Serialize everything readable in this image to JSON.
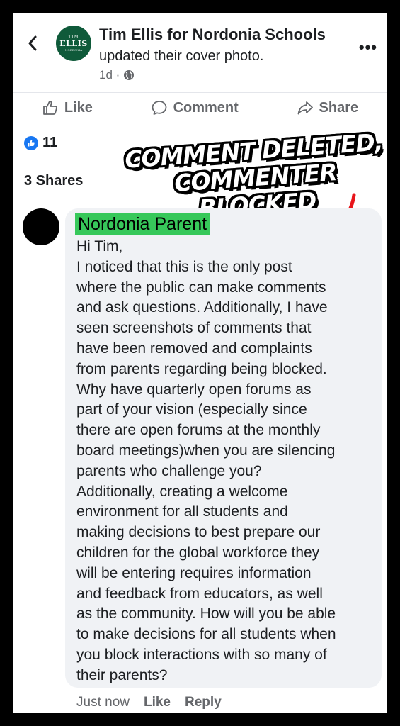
{
  "post": {
    "page_name": "Tim Ellis for Nordonia Schools",
    "action": "updated their cover photo.",
    "time": "1d ·",
    "logo_text": "ELLIS"
  },
  "icons": {
    "back": "chevron-left-icon",
    "more": "more-options-icon",
    "privacy": "globe-icon",
    "like": "thumbs-up-icon",
    "comment": "speech-bubble-icon",
    "share": "share-arrow-icon"
  },
  "actions": {
    "like_label": "Like",
    "comment_label": "Comment",
    "share_label": "Share"
  },
  "stats": {
    "likes": "11",
    "shares": "3 Shares"
  },
  "overlay": {
    "line1": "COMMENT DELETED,",
    "line2": "COMMENTER BLOCKED",
    "color": "#e8151b"
  },
  "comment": {
    "author": "Nordonia Parent",
    "highlight_color": "#37c85a",
    "text": "Hi Tim,\nI noticed that this is the only post\nwhere the public can make comments\nand ask questions. Additionally, I have\nseen screenshots of comments that\nhave been removed and complaints\nfrom parents regarding being blocked.\nWhy have quarterly open forums as\npart of your vision (especially since\nthere are open forums at the monthly\nboard meetings)when you are silencing\nparents who challenge you?\nAdditionally, creating a welcome\nenvironment for all students and\nmaking decisions to best prepare our\nchildren for the global workforce they\nwill be entering requires information\nand feedback from educators, as well\nas the community. How will you be able\nto make decisions for all students when\nyou block interactions with so many of\ntheir parents?",
    "time": "Just now",
    "like_label": "Like",
    "reply_label": "Reply"
  },
  "colors": {
    "brand_blue": "#1877f2",
    "muted_text": "#65676b",
    "bubble_bg": "#f0f2f5",
    "logo_green": "#0f5a3a"
  }
}
